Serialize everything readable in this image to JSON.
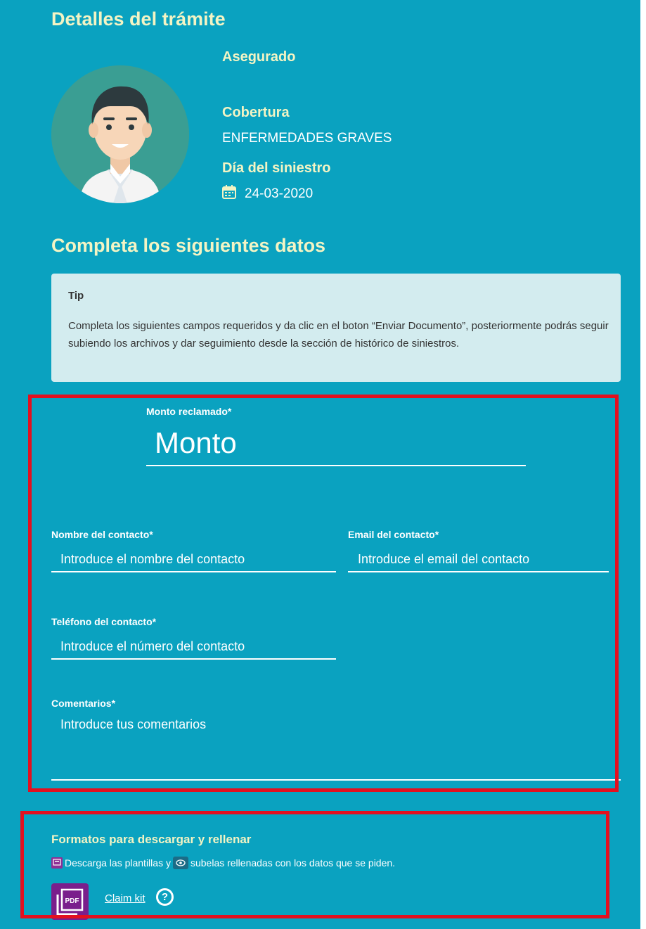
{
  "details": {
    "title": "Detalles del trámite",
    "insured_label": "Asegurado",
    "coverage_label": "Cobertura",
    "coverage_value": "ENFERMEDADES GRAVES",
    "incident_day_label": "Día del siniestro",
    "incident_date": "24-03-2020"
  },
  "form": {
    "title": "Completa los siguientes datos",
    "tip": {
      "title": "Tip",
      "text": "Completa los siguientes campos requeridos y da clic en el boton “Enviar Documento”, posteriormente podrás seguir subiendo los archivos y dar seguimiento desde la sección de histórico de siniestros."
    },
    "amount": {
      "label": "Monto reclamado*",
      "placeholder": "Monto"
    },
    "contact_name": {
      "label": "Nombre del contacto*",
      "placeholder": "Introduce el nombre del contacto"
    },
    "contact_email": {
      "label": "Email del contacto*",
      "placeholder": "Introduce el email del contacto"
    },
    "contact_phone": {
      "label": "Teléfono del contacto*",
      "placeholder": "Introduce el número del contacto"
    },
    "comments": {
      "label": "Comentarios*",
      "placeholder": "Introduce tus comentarios"
    }
  },
  "formats": {
    "title": "Formatos para descargar y rellenar",
    "desc_part1": "Descarga las plantillas y",
    "desc_part2": "subelas rellenadas con los datos que se piden.",
    "pdf_badge": "PDF",
    "claim_kit_link": "Claim kit",
    "help_glyph": "?"
  },
  "colors": {
    "background": "#0aa2c0",
    "heading": "#f3f4c4",
    "tip_background": "#d3ecef",
    "highlight_frame": "#e3101f",
    "pdf_purple": "#7a1f8c"
  },
  "icons": [
    "calendar-icon",
    "pdf-icon",
    "eye-upload-icon",
    "pdf-file-icon",
    "help-icon"
  ]
}
